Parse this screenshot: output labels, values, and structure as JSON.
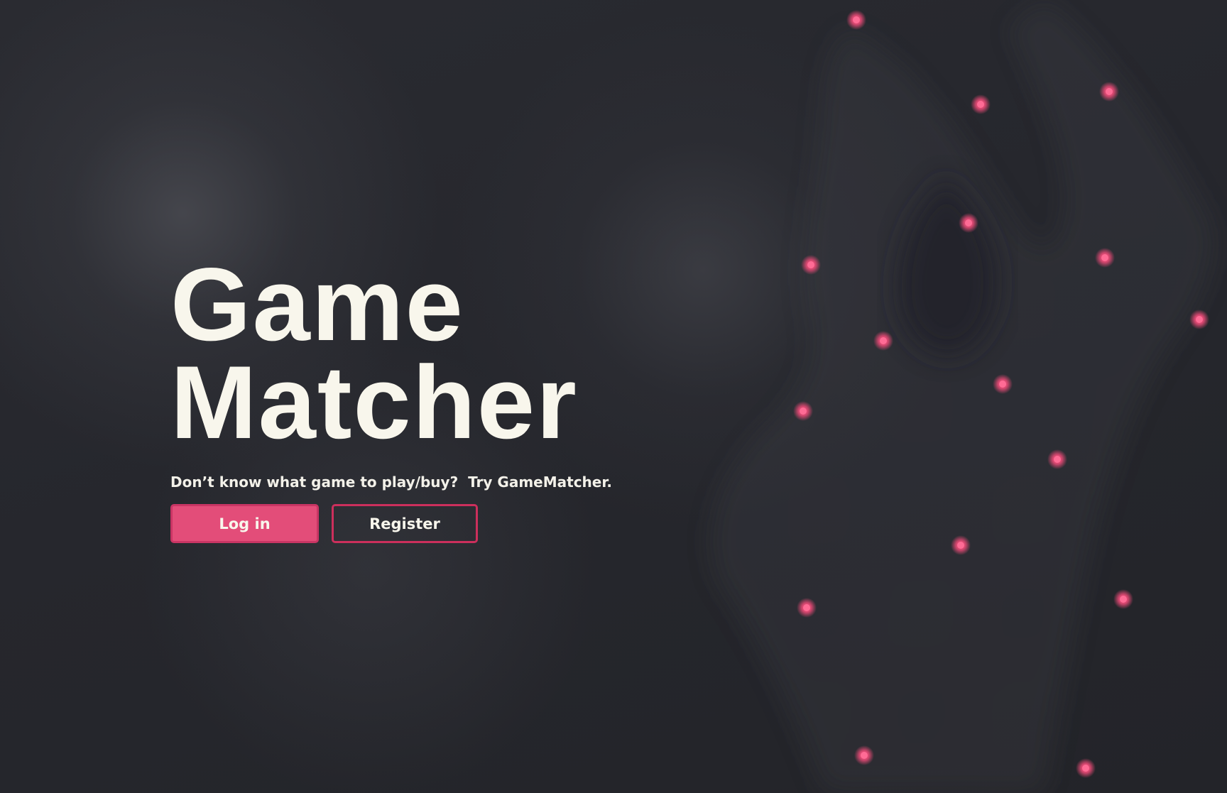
{
  "hero": {
    "title_line1": "Game",
    "title_line2": "Matcher",
    "tagline": "Don’t know what game to play/buy?  Try GameMatcher."
  },
  "buttons": {
    "login_label": "Log in",
    "register_label": "Register"
  },
  "colors": {
    "background": "#24252b",
    "accent": "#e34d79",
    "accent_border": "#cc2f5c",
    "text": "#f8f6ec",
    "dot": "#e84a76"
  }
}
